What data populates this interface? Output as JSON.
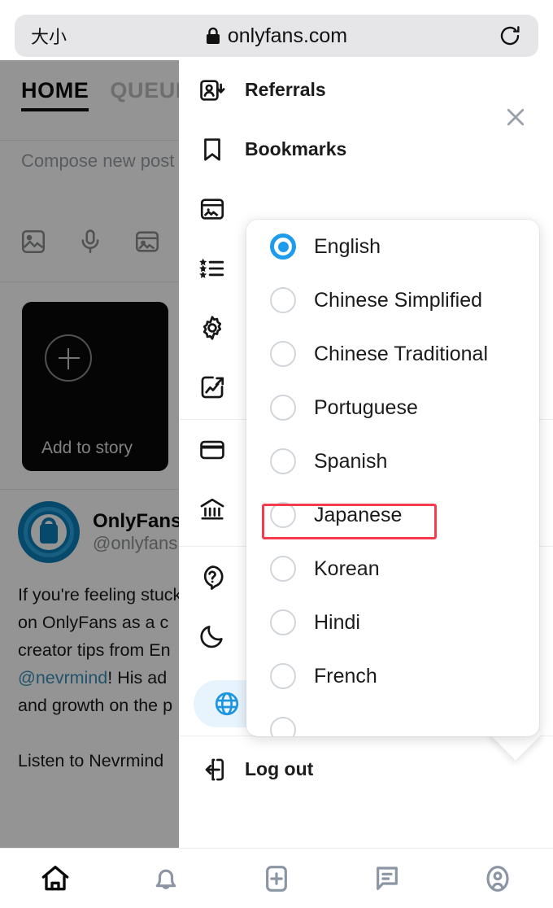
{
  "browser": {
    "text_size_label": "大小",
    "url": "onlyfans.com",
    "lock_icon": "lock-icon",
    "reload_icon": "reload-icon"
  },
  "app": {
    "tabs": [
      {
        "label": "HOME",
        "active": true
      },
      {
        "label": "QUEUE",
        "active": false
      }
    ],
    "compose_placeholder": "Compose new post",
    "compose_icons": [
      "image-icon",
      "microphone-icon",
      "gallery-icon"
    ],
    "story": {
      "label": "Add to story",
      "icon": "plus-circle-icon"
    },
    "post": {
      "author_name": "OnlyFans",
      "author_handle": "@onlyfans",
      "body_line1": "If you're feeling stuck",
      "body_line2": "on OnlyFans as a c",
      "body_line3": "creator tips from En",
      "body_mention": "@nevrmind",
      "body_line4_rest": "! His ad",
      "body_line5": "and growth on the p",
      "body_line6": "Listen to Nevrmind"
    }
  },
  "drawer": {
    "close_icon": "close-icon",
    "items": [
      {
        "label": "Referrals",
        "icon": "person-add-icon"
      },
      {
        "label": "Bookmarks",
        "icon": "bookmark-icon"
      },
      {
        "label": "",
        "icon": "collections-icon"
      },
      {
        "label": "",
        "icon": "starred-list-icon"
      },
      {
        "label": "",
        "icon": "gear-icon"
      },
      {
        "label": "",
        "icon": "statistics-icon"
      },
      {
        "label": "",
        "icon": "card-icon"
      },
      {
        "label": "",
        "icon": "bank-icon"
      },
      {
        "label": "",
        "icon": "help-icon"
      },
      {
        "label": "",
        "icon": "moon-icon"
      }
    ],
    "language_row": {
      "label": "English",
      "icon": "globe-icon",
      "chevron": "chevron-down-icon",
      "accent": "#1d94e0",
      "background": "#e8f4fd"
    },
    "logout": {
      "label": "Log out",
      "icon": "logout-icon"
    }
  },
  "language_dropdown": {
    "selected": "English",
    "highlighted": "Japanese",
    "highlight_color": "#f63b4d",
    "accent": "#1d9bec",
    "options": [
      {
        "label": "English",
        "selected": true
      },
      {
        "label": "Chinese Simplified",
        "selected": false
      },
      {
        "label": "Chinese Traditional",
        "selected": false
      },
      {
        "label": "Portuguese",
        "selected": false
      },
      {
        "label": "Spanish",
        "selected": false
      },
      {
        "label": "Japanese",
        "selected": false
      },
      {
        "label": "Korean",
        "selected": false
      },
      {
        "label": "Hindi",
        "selected": false
      },
      {
        "label": "French",
        "selected": false
      }
    ]
  },
  "bottom_nav": {
    "items": [
      {
        "icon": "home-icon",
        "active": true
      },
      {
        "icon": "bell-icon",
        "active": false
      },
      {
        "icon": "add-post-icon",
        "active": false
      },
      {
        "icon": "messages-icon",
        "active": false
      },
      {
        "icon": "profile-icon",
        "active": false
      }
    ]
  }
}
